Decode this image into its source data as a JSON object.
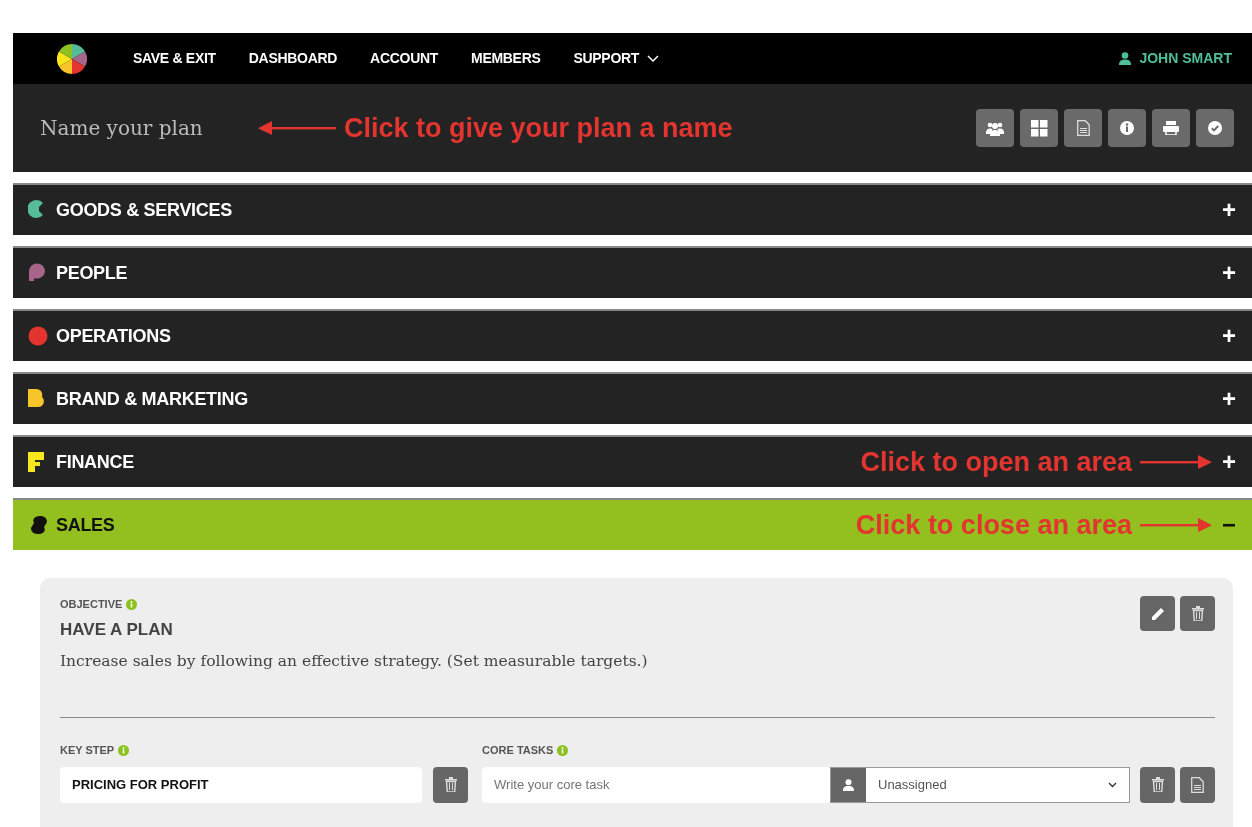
{
  "nav": {
    "items": [
      {
        "label": "SAVE & EXIT",
        "dropdown": false
      },
      {
        "label": "DASHBOARD",
        "dropdown": false
      },
      {
        "label": "ACCOUNT",
        "dropdown": false
      },
      {
        "label": "MEMBERS",
        "dropdown": false
      },
      {
        "label": "SUPPORT",
        "dropdown": true
      }
    ],
    "user": "JOHN SMART"
  },
  "plan": {
    "placeholder": "Name your plan",
    "annotation": "Click to give your plan a name",
    "tools": [
      {
        "kind": "team"
      },
      {
        "kind": "grid"
      },
      {
        "kind": "document"
      },
      {
        "kind": "info"
      },
      {
        "kind": "print"
      },
      {
        "kind": "check"
      }
    ]
  },
  "areas": [
    {
      "label": "GOODS & SERVICES",
      "kind": "c",
      "color": "#55bb99",
      "expanded": false,
      "toggle": "+"
    },
    {
      "label": "PEOPLE",
      "kind": "p",
      "color": "#a8658a",
      "expanded": false,
      "toggle": "+"
    },
    {
      "label": "OPERATIONS",
      "kind": "circle",
      "color": "#e3342f",
      "expanded": false,
      "toggle": "+"
    },
    {
      "label": "BRAND & MARKETING",
      "kind": "b",
      "color": "#f5c52a",
      "expanded": false,
      "toggle": "+"
    },
    {
      "label": "FINANCE",
      "kind": "f",
      "color": "#f8e71c",
      "expanded": false,
      "toggle": "+",
      "annotation": "Click to open an area"
    },
    {
      "label": "SALES",
      "kind": "s",
      "color": "#111111",
      "expanded": true,
      "toggle": "−",
      "annotation": "Click to close an area"
    }
  ],
  "objective": {
    "label": "OBJECTIVE",
    "title": "HAVE A PLAN",
    "description": "Increase sales by following an effective strategy. (Set measurable targets.)",
    "key_step": {
      "label": "KEY STEP",
      "value": "PRICING FOR PROFIT"
    },
    "core_tasks": {
      "label": "CORE TASKS",
      "placeholder": "Write your core task",
      "assignee": "Unassigned"
    }
  }
}
